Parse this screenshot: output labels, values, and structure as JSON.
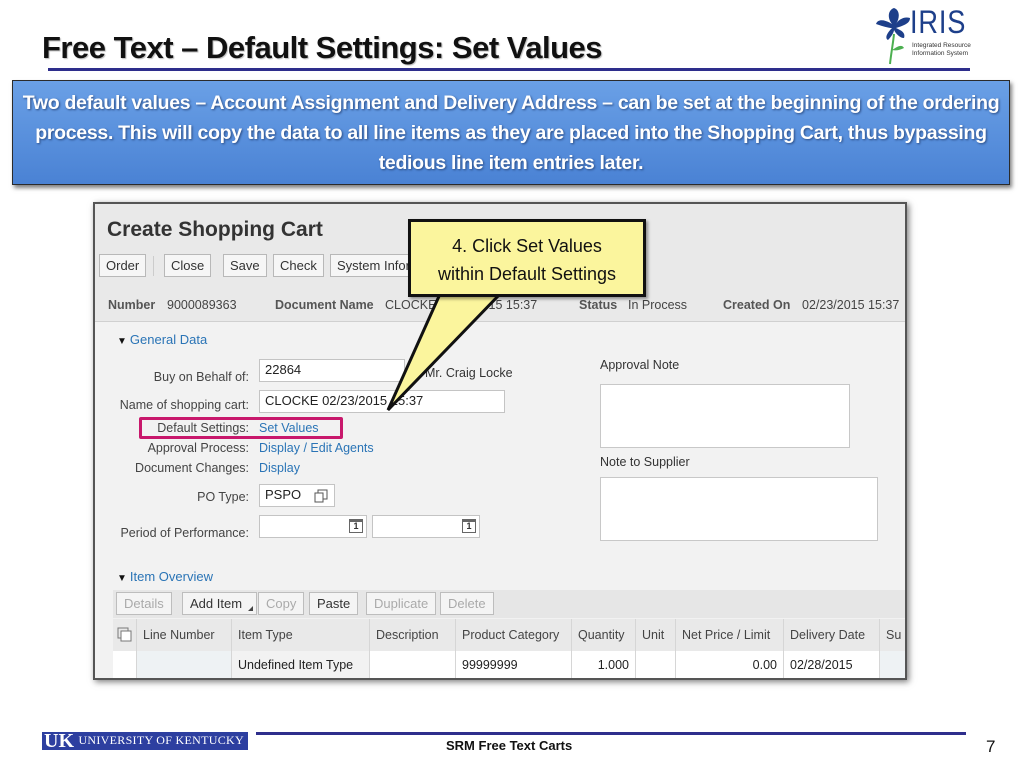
{
  "slide": {
    "title": "Free Text – Default Settings: Set Values",
    "logo": {
      "word": "IRIS",
      "line1": "Integrated Resource",
      "line2": "Information System"
    },
    "banner_text": "Two default values – Account Assignment and Delivery Address – can be set at the beginning of the ordering process. This will copy the data to all line items as they are placed into the Shopping Cart, thus bypassing tedious line item entries later.",
    "callout": {
      "line1": "4. Click Set Values",
      "line2": "within Default Settings"
    },
    "footer": {
      "uk_logo": {
        "uk": "UK",
        "text": "UNIVERSITY OF KENTUCKY"
      },
      "center_text": "SRM Free Text Carts",
      "page_number": "7"
    },
    "colors": {
      "title_rule": "#2e2e8c",
      "banner": "#5b92dd",
      "callout_fill": "#fbf59d",
      "highlight": "#c8186c",
      "link": "#2a74b6"
    }
  },
  "sap": {
    "title": "Create Shopping Cart",
    "toolbar": [
      "Order",
      "Close",
      "Save",
      "Check",
      "System Infor"
    ],
    "meta": {
      "number_label": "Number",
      "number_value": "9000089363",
      "docname_label": "Document Name",
      "docname_value": "CLOCKE 02/23/2015 15:37",
      "status_label": "Status",
      "status_value": "In Process",
      "created_label": "Created On",
      "created_value": "02/23/2015 15:37"
    },
    "general_data": {
      "toggle": "General Data",
      "buy_on_behalf_label": "Buy on Behalf of:",
      "buy_on_behalf_value": "22864",
      "buy_on_behalf_name": "Mr. Craig Locke",
      "cart_name_label": "Name of shopping cart:",
      "cart_name_value": "CLOCKE 02/23/2015 15:37",
      "default_settings_label": "Default Settings:",
      "default_settings_link": "Set Values",
      "approval_process_label": "Approval Process:",
      "approval_process_link": "Display / Edit Agents",
      "document_changes_label": "Document Changes:",
      "document_changes_link": "Display",
      "po_type_label": "PO Type:",
      "po_type_value": "PSPO",
      "period_label": "Period of Performance:",
      "period_from": "",
      "period_to": "",
      "calendar_day": "1",
      "approval_note_label": "Approval Note",
      "note_to_supplier_label": "Note to Supplier"
    },
    "item_overview": {
      "toggle": "Item Overview",
      "buttons": [
        {
          "label": "Details",
          "enabled": false
        },
        {
          "label": "Add Item",
          "enabled": true
        },
        {
          "label": "Copy",
          "enabled": false
        },
        {
          "label": "Paste",
          "enabled": true
        },
        {
          "label": "Duplicate",
          "enabled": false
        },
        {
          "label": "Delete",
          "enabled": false
        }
      ],
      "columns": [
        "Line Number",
        "Item Type",
        "Description",
        "Product Category",
        "Quantity",
        "Unit",
        "Net Price / Limit",
        "Delivery Date",
        "Su"
      ],
      "rows": [
        {
          "line_number": "",
          "item_type": "Undefined Item Type",
          "description": "",
          "product_category": "99999999",
          "quantity": "1.000",
          "unit": "",
          "net_price": "0.00",
          "delivery_date": "02/28/2015",
          "su": ""
        }
      ]
    }
  }
}
